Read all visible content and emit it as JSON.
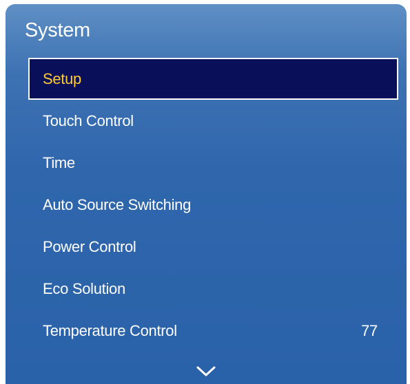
{
  "panel": {
    "title": "System"
  },
  "menu": {
    "items": [
      {
        "label": "Setup",
        "selected": true,
        "value": ""
      },
      {
        "label": "Touch Control",
        "selected": false,
        "value": ""
      },
      {
        "label": "Time",
        "selected": false,
        "value": ""
      },
      {
        "label": "Auto Source Switching",
        "selected": false,
        "value": ""
      },
      {
        "label": "Power Control",
        "selected": false,
        "value": ""
      },
      {
        "label": "Eco Solution",
        "selected": false,
        "value": ""
      },
      {
        "label": "Temperature Control",
        "selected": false,
        "value": "77"
      }
    ]
  },
  "icons": {
    "scroll_down": "chevron-down-icon"
  },
  "colors": {
    "panel_bg": "#2f66ac",
    "selected_bg": "#0a0f5a",
    "selected_text": "#ffcc33",
    "text": "#ffffff"
  }
}
